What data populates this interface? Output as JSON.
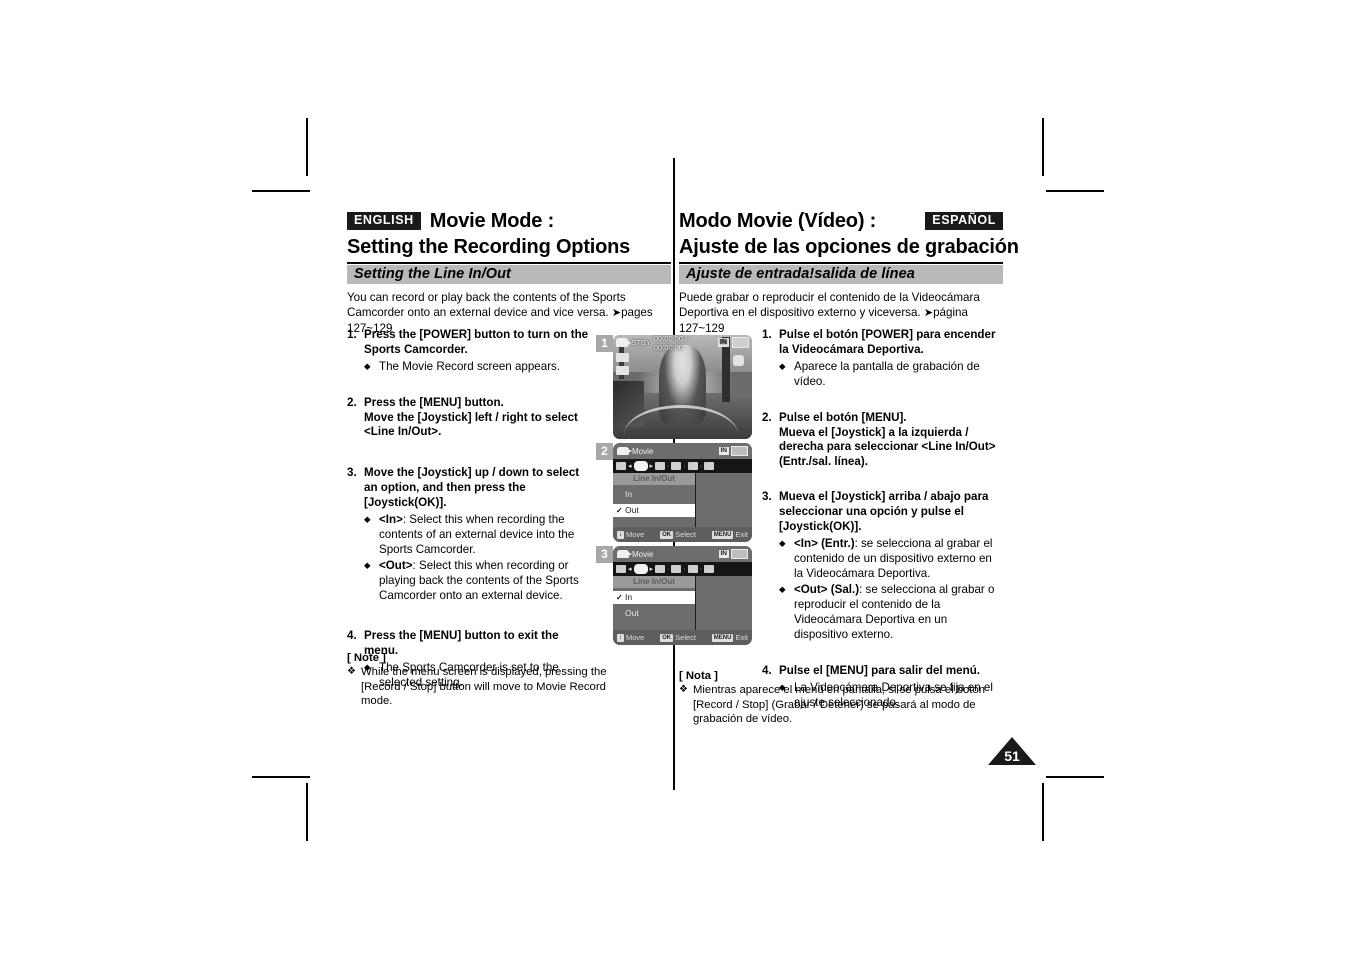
{
  "document": {
    "page_number": "51"
  },
  "english": {
    "lang_tag": "ENGLISH",
    "title_line1": "Movie Mode :",
    "title_line2": "Setting the Recording Options",
    "section_band": "Setting the Line In/Out",
    "intro": "You can record or play back the contents of the Sports Camcorder onto an external device and vice versa.",
    "intro_ref": "pages 127~129",
    "steps": [
      {
        "num": "1.",
        "head": "Press the [POWER] button to turn on the Sports Camcorder.",
        "bullets": [
          {
            "lead": "",
            "text": "The Movie Record screen appears."
          }
        ]
      },
      {
        "num": "2.",
        "head": "Press the [MENU] button.\nMove the [Joystick] left / right to select <Line In/Out>.",
        "bullets": []
      },
      {
        "num": "3.",
        "head": "Move the [Joystick] up / down to select an option, and then press the [Joystick(OK)].",
        "bullets": [
          {
            "lead": "<In>",
            "text": ": Select this when recording the contents of an external device into the Sports Camcorder."
          },
          {
            "lead": "<Out>",
            "text": ": Select this when recording or playing back the contents of the Sports Camcorder onto an external device."
          }
        ]
      },
      {
        "num": "4.",
        "head": "Press the [MENU] button to exit the menu.",
        "bullets": [
          {
            "lead": "",
            "text": "The Sports Camcorder is set to the selected setting."
          }
        ]
      }
    ],
    "note_title": "[ Note ]",
    "note_text": "While the menu screen is displayed, pressing the [Record / Stop] button will move to Movie Record mode."
  },
  "spanish": {
    "lang_tag": "ESPAÑOL",
    "title_line1": "Modo Movie (Vídeo) :",
    "title_line2": "Ajuste de las opciones de grabación",
    "section_band": "Ajuste de entrada!salida de línea",
    "intro": "Puede grabar o reproducir el contenido de la Videocámara Deportiva en el dispositivo externo y viceversa.",
    "intro_ref": "página 127~129",
    "steps": [
      {
        "num": "1.",
        "head": "Pulse el botón [POWER] para encender la Videocámara Deportiva.",
        "bullets": [
          {
            "lead": "",
            "text": "Aparece la pantalla de grabación de vídeo."
          }
        ]
      },
      {
        "num": "2.",
        "head": "Pulse el botón [MENU].\nMueva el [Joystick] a la izquierda / derecha para seleccionar <Line In/Out> (Entr./sal. línea).",
        "bullets": []
      },
      {
        "num": "3.",
        "head": "Mueva el [Joystick] arriba / abajo para seleccionar una opción y pulse el [Joystick(OK)].",
        "bullets": [
          {
            "lead": "<In> (Entr.)",
            "text": ": se selecciona al grabar el contenido de un dispositivo externo en la Videocámara Deportiva."
          },
          {
            "lead": "<Out> (Sal.)",
            "text": ": se selecciona al grabar o reproducir el contenido de la Videocámara Deportiva en un dispositivo externo."
          }
        ]
      },
      {
        "num": "4.",
        "head": "Pulse el [MENU] para salir del menú.",
        "bullets": [
          {
            "lead": "",
            "text": "La Videocámara Deportiva se fija en el ajuste seleccionado."
          }
        ]
      }
    ],
    "note_title": "[ Nota ]",
    "note_text": "Mientras aparece el menú en pantalla, si se pulsa el botón [Record / Stop] (Grabar / Detener) se pasará al modo de grabación de vídeo."
  },
  "screens": {
    "chips": [
      "1",
      "2",
      "3"
    ],
    "record_screen": {
      "status": "STBY",
      "timecode": "00:00:00 / 00:00:00",
      "line_mode": "IN"
    },
    "menu2": {
      "title": "Movie",
      "line_mode": "IN",
      "heading": "Line In/Out",
      "options": [
        "In",
        "Out"
      ],
      "selected": "Out",
      "footer": [
        {
          "key": "↕",
          "label": "Move"
        },
        {
          "key": "OK",
          "label": "Select"
        },
        {
          "key": "MENU",
          "label": "Exit"
        }
      ]
    },
    "menu3": {
      "title": "Movie",
      "line_mode": "IN",
      "heading": "Line In/Out",
      "options": [
        "In",
        "Out"
      ],
      "selected": "In",
      "footer": [
        {
          "key": "↕",
          "label": "Move"
        },
        {
          "key": "OK",
          "label": "Select"
        },
        {
          "key": "MENU",
          "label": "Exit"
        }
      ]
    }
  }
}
